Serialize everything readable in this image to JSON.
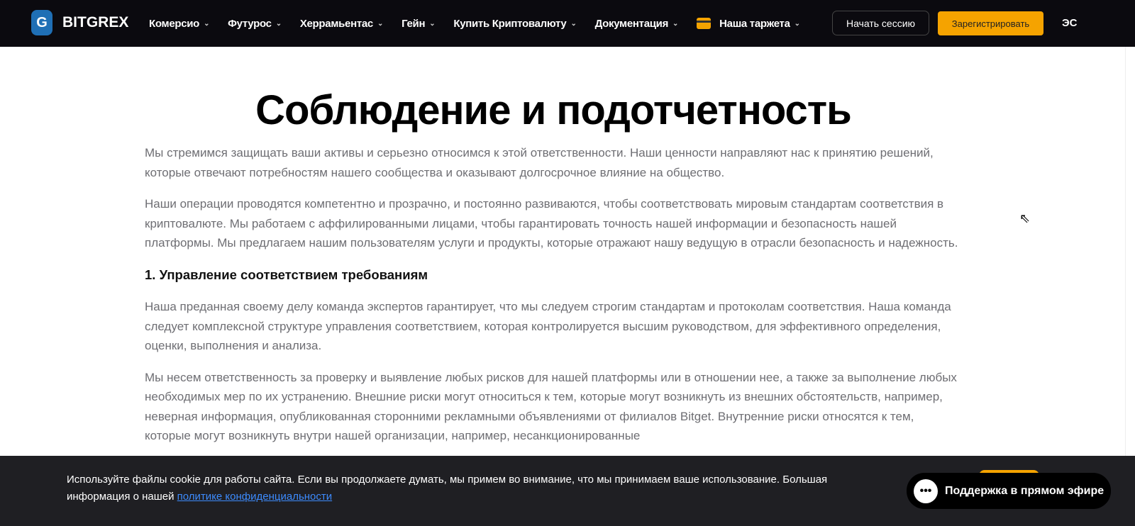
{
  "nav": {
    "brand": "BITGREX",
    "logo_letter": "G",
    "items": [
      {
        "label": "Комерсио"
      },
      {
        "label": "Футурос"
      },
      {
        "label": "Херрамьентас"
      },
      {
        "label": "Гейн"
      },
      {
        "label": "Купить Криптовалюту"
      },
      {
        "label": "Документация"
      },
      {
        "label": "Наша таржета"
      }
    ],
    "login": "Начать сессию",
    "register": "Зарегистрировать",
    "lang": "ЭС",
    "accent": "#f5a300"
  },
  "page": {
    "title": "Соблюдение и подотчетность",
    "paragraphs": [
      "Мы стремимся защищать ваши активы и серьезно относимся к этой ответственности. Наши ценности направляют нас к принятию решений, которые отвечают потребностям нашего сообщества и оказывают долгосрочное влияние на общество.",
      "Наши операции проводятся компетентно и прозрачно, и постоянно развиваются, чтобы соответствовать мировым стандартам соответствия в криптовалюте. Мы работаем с аффилированными лицами, чтобы гарантировать точность нашей информации и безопасность нашей платформы. Мы предлагаем нашим пользователям услуги и продукты, которые отражают нашу ведущую в отрасли безопасность и надежность."
    ],
    "section1": {
      "heading": "1. Управление соответствием требованиям",
      "paragraphs": [
        "Наша преданная своему делу команда экспертов гарантирует, что мы следуем строгим стандартам и протоколам соответствия. Наша команда следует комплексной структуре управления соответствием, которая контролируется высшим руководством, для эффективного определения, оценки, выполнения и анализа.",
        "Мы несем ответственность за проверку и выявление любых рисков для нашей платформы или в отношении нее, а также за выполнение любых необходимых мер по их устранению. Внешние риски могут относиться к тем, которые могут возникнуть из внешних обстоятельств, например, неверная информация, опубликованная сторонними рекламными объявлениями от филиалов Bitget. Внутренние риски относятся к тем, которые могут возникнуть внутри нашей организации, например, несанкционированные"
      ]
    }
  },
  "cookie": {
    "text": "Используйте файлы cookie для работы сайта. Если вы продолжаете думать, мы примем во внимание, что мы принимаем ваше использование. Большая информация о нашей ",
    "link": "политике конфиденциальности"
  },
  "support": {
    "label": "Поддержка в прямом эфире"
  }
}
